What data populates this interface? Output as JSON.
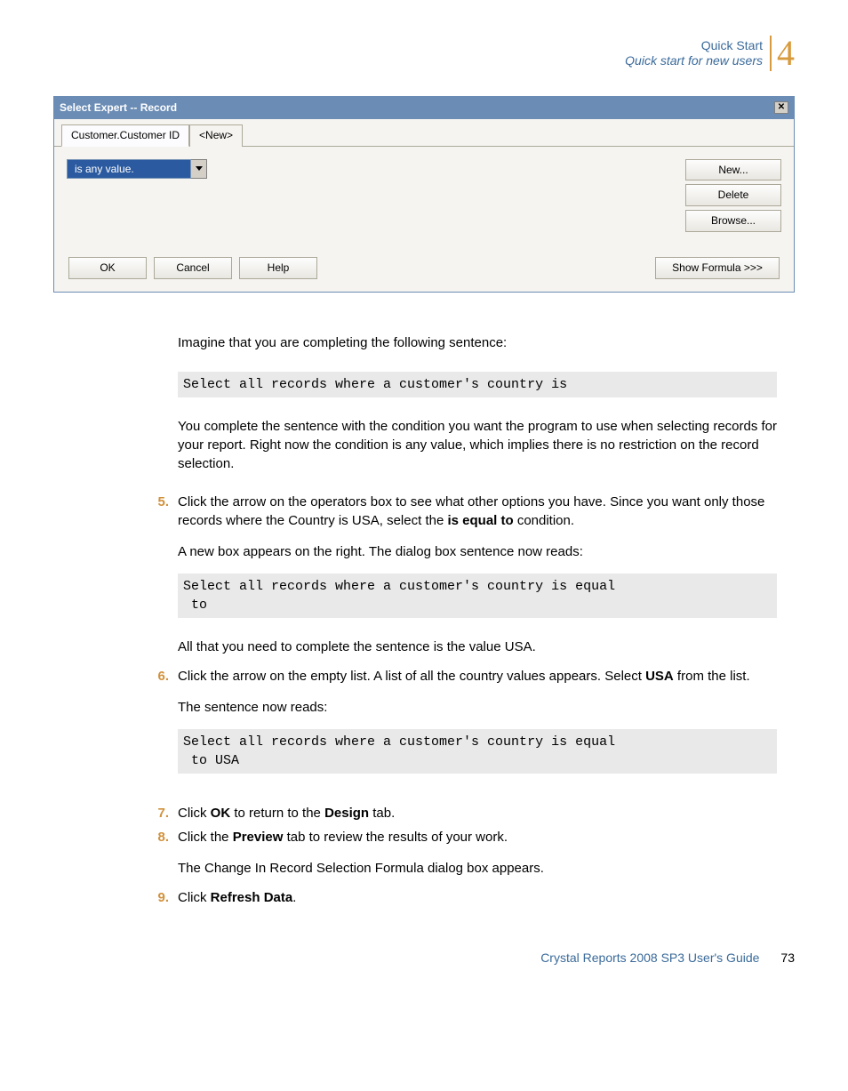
{
  "header": {
    "line1": "Quick Start",
    "line2": "Quick start for new users",
    "chapter": "4"
  },
  "dialog": {
    "title": "Select Expert -- Record",
    "tabs": {
      "active": "Customer.Customer ID",
      "new": "<New>"
    },
    "combo_value": "is any value.",
    "buttons": {
      "new": "New...",
      "delete": "Delete",
      "browse": "Browse..."
    },
    "footer": {
      "ok": "OK",
      "cancel": "Cancel",
      "help": "Help",
      "show_formula": "Show Formula >>>"
    }
  },
  "body": {
    "intro": "Imagine that you are completing the following sentence:",
    "code1": "Select all records where a customer's country is",
    "para_complete": "You complete the sentence with the condition you want the program to use when selecting records for your report. Right now the condition is any value, which implies there is no restriction on the record selection.",
    "step5_a": "Click the arrow on the operators box to see what other options you have. Since you want only those records where the Country is USA, select the ",
    "step5_bold": "is equal to",
    "step5_b": " condition.",
    "step5_c": "A new box appears on the right. The dialog box sentence now reads:",
    "code2": "Select all records where a customer's country is equal\n to",
    "step5_d": "All that you need to complete the sentence is the value USA.",
    "step6_a": "Click the arrow on the empty list. A list of all the country values appears. Select ",
    "step6_bold": "USA",
    "step6_b": " from the list.",
    "step6_c": "The sentence now reads:",
    "code3": "Select all records where a customer's country is equal\n to USA",
    "step7_a": "Click ",
    "step7_ok": "OK",
    "step7_b": " to return to the ",
    "step7_design": "Design",
    "step7_c": " tab.",
    "step8_a": "Click the ",
    "step8_bold": "Preview",
    "step8_b": " tab to review the results of your work.",
    "step8_c": "The Change In Record Selection Formula dialog box appears.",
    "step9_a": "Click ",
    "step9_bold": "Refresh Data",
    "step9_b": "."
  },
  "nums": {
    "s5": "5.",
    "s6": "6.",
    "s7": "7.",
    "s8": "8.",
    "s9": "9."
  },
  "footer": {
    "title": "Crystal Reports 2008 SP3 User's Guide",
    "page": "73"
  }
}
